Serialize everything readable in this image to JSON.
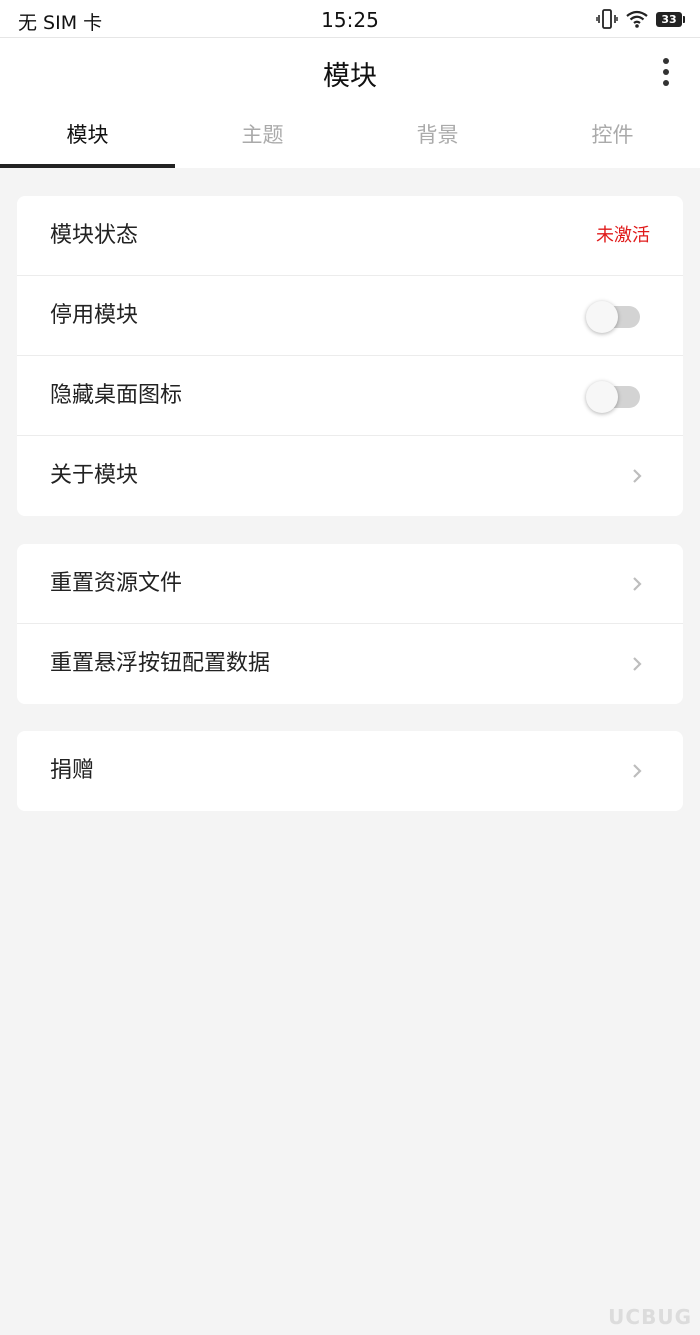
{
  "status_bar": {
    "carrier": "无 SIM 卡",
    "time": "15:25",
    "battery": "33"
  },
  "header": {
    "title": "模块"
  },
  "tabs": [
    {
      "label": "模块",
      "active": true
    },
    {
      "label": "主题",
      "active": false
    },
    {
      "label": "背景",
      "active": false
    },
    {
      "label": "控件",
      "active": false
    }
  ],
  "group1": {
    "module_status_label": "模块状态",
    "module_status_value": "未激活",
    "disable_module_label": "停用模块",
    "disable_module_on": false,
    "hide_icon_label": "隐藏桌面图标",
    "hide_icon_on": false,
    "about_label": "关于模块"
  },
  "group2": {
    "reset_resources_label": "重置资源文件",
    "reset_float_label": "重置悬浮按钮配置数据"
  },
  "group3": {
    "donate_label": "捐赠"
  },
  "watermark": "UCBUG",
  "colors": {
    "status_inactive": "#e01b1b",
    "tab_active": "#111111",
    "tab_inactive": "#aaaaaa",
    "background": "#f4f4f4"
  }
}
